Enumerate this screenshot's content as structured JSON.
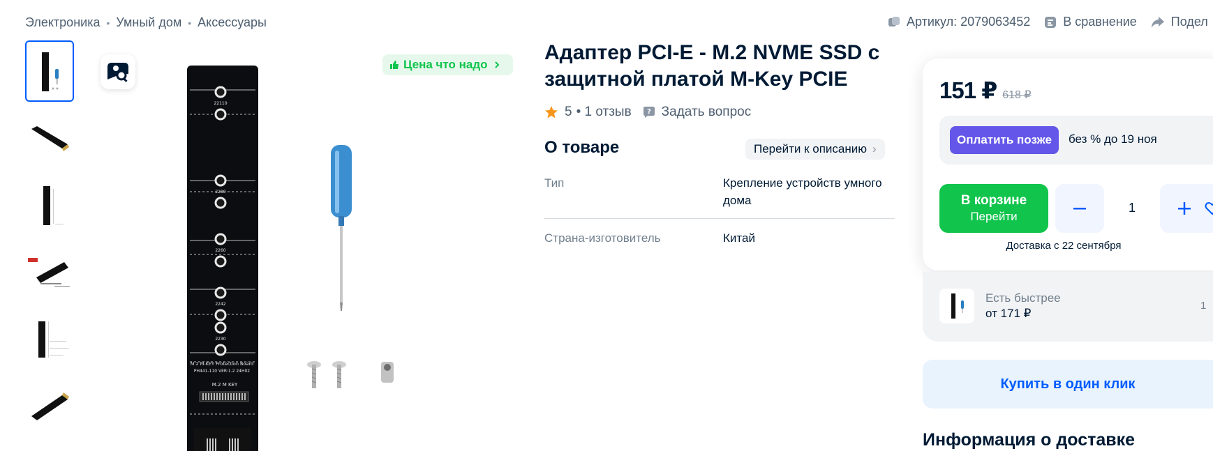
{
  "breadcrumb": [
    "Электроника",
    "Умный дом",
    "Аксессуары"
  ],
  "top_actions": {
    "article": "Артикул: 2079063452",
    "compare": "В сравнение",
    "share": "Подел"
  },
  "promo_badge": "Цена что надо",
  "product": {
    "title": "Адаптер PCI-E - M.2 NVME SSD с защитной платой M-Key PCIE",
    "rating_value": "5",
    "reviews": "• 1 отзыв",
    "ask_question": "Задать вопрос",
    "board_print": [
      "M.2 M-KEY Protection Board",
      "PH441-110  VER:1.2  24H02",
      "M.2 M KEY",
      "22110",
      "2280",
      "2260",
      "2242",
      "2230"
    ]
  },
  "about": {
    "heading": "О товаре",
    "to_description": "Перейти к описанию",
    "specs": [
      {
        "key": "Тип",
        "value": "Крепление устройств умного дома"
      },
      {
        "key": "Страна-изготовитель",
        "value": "Китай"
      }
    ]
  },
  "buy": {
    "price": "151 ₽",
    "old_price": "618 ₽",
    "pay_later_button": "Оплатить позже",
    "pay_later_text": "без % до 19 ноя",
    "in_cart_label": "В корзине",
    "in_cart_sub": "Перейти",
    "quantity": "1",
    "delivery": "Доставка с 22 сентября",
    "faster_label": "Есть быстрее",
    "faster_price": "от 171 ₽",
    "faster_extra": "1",
    "one_click": "Купить в один клик"
  },
  "delivery_info_heading": "Информация о доставке",
  "colors": {
    "accent": "#005bff",
    "green": "#10c44c",
    "purple": "#6356e8",
    "star": "#f79518"
  }
}
